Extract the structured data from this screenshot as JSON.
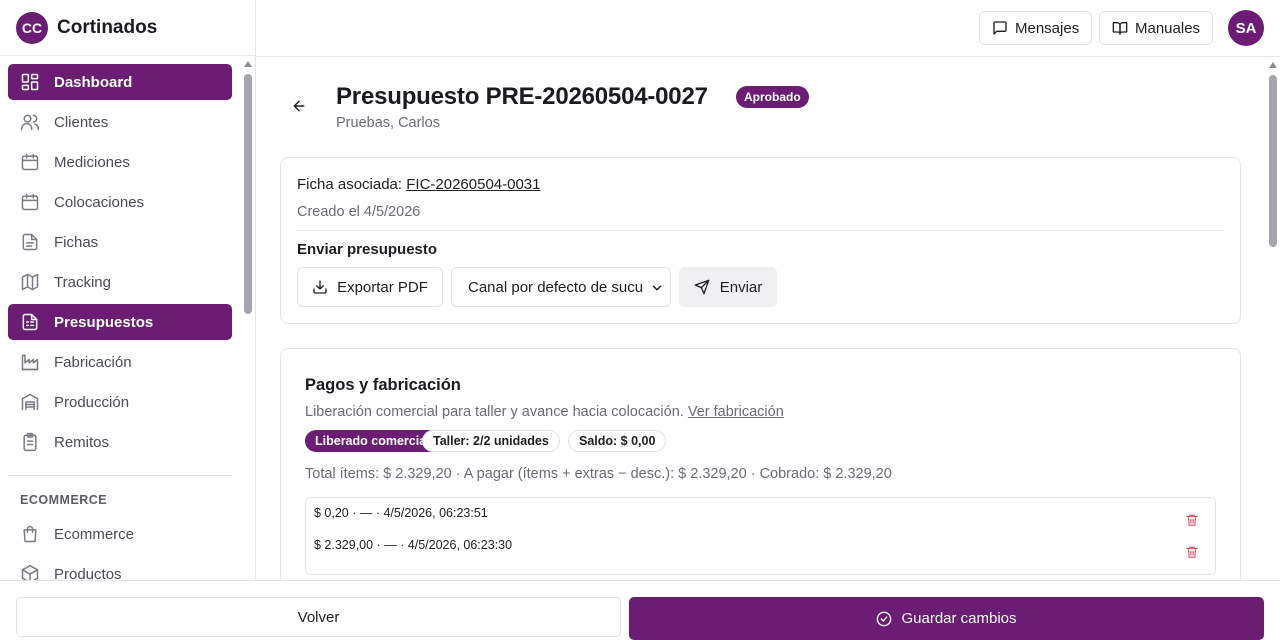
{
  "brand": {
    "logo": "CC",
    "name": "Cortinados"
  },
  "sidebar": {
    "items": [
      {
        "label": "Dashboard",
        "icon": "dashboard-icon",
        "active": true
      },
      {
        "label": "Clientes",
        "icon": "users-icon",
        "active": false
      },
      {
        "label": "Mediciones",
        "icon": "calendar-icon",
        "active": false
      },
      {
        "label": "Colocaciones",
        "icon": "calendar-icon",
        "active": false
      },
      {
        "label": "Fichas",
        "icon": "file-icon",
        "active": false
      },
      {
        "label": "Tracking",
        "icon": "map-icon",
        "active": false
      },
      {
        "label": "Presupuestos",
        "icon": "spreadsheet-icon",
        "active": true
      },
      {
        "label": "Fabricación",
        "icon": "factory-icon",
        "active": false
      },
      {
        "label": "Producción",
        "icon": "warehouse-icon",
        "active": false
      },
      {
        "label": "Remitos",
        "icon": "clipboard-icon",
        "active": false
      }
    ],
    "section_ecommerce": "ECOMMERCE",
    "ecommerce_items": [
      {
        "label": "Ecommerce",
        "icon": "shopping-bag-icon"
      },
      {
        "label": "Productos",
        "icon": "package-icon"
      }
    ]
  },
  "topbar": {
    "messages_label": "Mensajes",
    "manuals_label": "Manuales",
    "avatar": "SA"
  },
  "header": {
    "title": "Presupuesto PRE-20260504-0027",
    "status": "Aprobado",
    "subtitle": "Pruebas, Carlos"
  },
  "summary": {
    "ficha_label": "Ficha asociada:",
    "ficha_link": "FIC-20260504-0031",
    "created": "Creado el 4/5/2026",
    "send_title": "Enviar presupuesto",
    "export_label": "Exportar PDF",
    "channel_selected": "Canal por defecto de sucu",
    "send_label": "Enviar"
  },
  "payments": {
    "title": "Pagos y fabricación",
    "description": "Liberación comercial para taller y avance hacia colocación.",
    "link": "Ver fabricación",
    "badges": [
      "Liberado comercial",
      "Taller: 2/2 unidades",
      "Saldo: $ 0,00"
    ],
    "totals": "Total ítems: $ 2.329,20 · A pagar (ítems + extras − desc.): $ 2.329,20 · Cobrado: $ 2.329,20",
    "rows": [
      "$ 0,20 · — · 4/5/2026, 06:23:51",
      "$ 2.329,00 · — · 4/5/2026, 06:23:30"
    ]
  },
  "footer": {
    "back_label": "Volver",
    "save_label": "Guardar cambios"
  },
  "colors": {
    "accent": "#6b1d74",
    "trash": "#e05b6b"
  }
}
